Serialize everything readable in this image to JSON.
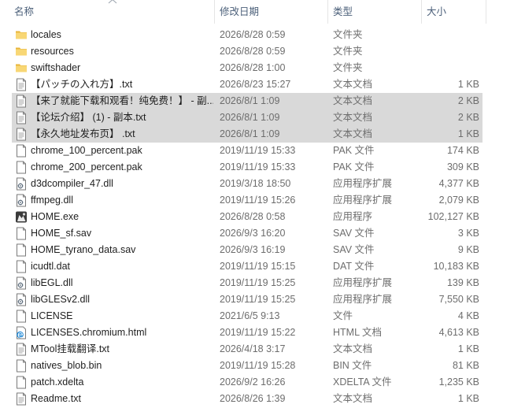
{
  "columns": {
    "name": "名称",
    "date": "修改日期",
    "type": "类型",
    "size": "大小"
  },
  "files": [
    {
      "name": "locales",
      "date": "2026/8/28 0:59",
      "type": "文件夹",
      "size": "",
      "icon": "folder-icon",
      "selected": false
    },
    {
      "name": "resources",
      "date": "2026/8/28 0:59",
      "type": "文件夹",
      "size": "",
      "icon": "folder-icon",
      "selected": false
    },
    {
      "name": "swiftshader",
      "date": "2026/8/28 1:00",
      "type": "文件夹",
      "size": "",
      "icon": "folder-icon",
      "selected": false
    },
    {
      "name": "【パッチの入れ方】.txt",
      "date": "2026/8/23 15:27",
      "type": "文本文档",
      "size": "1 KB",
      "icon": "text-file-icon",
      "selected": false
    },
    {
      "name": "【来了就能下载和观看！纯免费！】 - 副...",
      "date": "2026/8/1 1:09",
      "type": "文本文档",
      "size": "2 KB",
      "icon": "text-file-icon",
      "selected": true
    },
    {
      "name": "【论坛介绍】 (1) - 副本.txt",
      "date": "2026/8/1 1:09",
      "type": "文本文档",
      "size": "2 KB",
      "icon": "text-file-icon",
      "selected": true
    },
    {
      "name": "【永久地址发布页】 .txt",
      "date": "2026/8/1 1:09",
      "type": "文本文档",
      "size": "1 KB",
      "icon": "text-file-icon",
      "selected": true
    },
    {
      "name": "chrome_100_percent.pak",
      "date": "2019/11/19 15:33",
      "type": "PAK 文件",
      "size": "174 KB",
      "icon": "blank-file-icon",
      "selected": false
    },
    {
      "name": "chrome_200_percent.pak",
      "date": "2019/11/19 15:33",
      "type": "PAK 文件",
      "size": "309 KB",
      "icon": "blank-file-icon",
      "selected": false
    },
    {
      "name": "d3dcompiler_47.dll",
      "date": "2019/3/18 18:50",
      "type": "应用程序扩展",
      "size": "4,377 KB",
      "icon": "dll-file-icon",
      "selected": false
    },
    {
      "name": "ffmpeg.dll",
      "date": "2019/11/19 15:26",
      "type": "应用程序扩展",
      "size": "2,079 KB",
      "icon": "dll-file-icon",
      "selected": false
    },
    {
      "name": "HOME.exe",
      "date": "2026/8/28 0:58",
      "type": "应用程序",
      "size": "102,127 KB",
      "icon": "app-exe-icon",
      "selected": false
    },
    {
      "name": "HOME_sf.sav",
      "date": "2026/9/3 16:20",
      "type": "SAV 文件",
      "size": "3 KB",
      "icon": "blank-file-icon",
      "selected": false
    },
    {
      "name": "HOME_tyrano_data.sav",
      "date": "2026/9/3 16:19",
      "type": "SAV 文件",
      "size": "9 KB",
      "icon": "blank-file-icon",
      "selected": false
    },
    {
      "name": "icudtl.dat",
      "date": "2019/11/19 15:15",
      "type": "DAT 文件",
      "size": "10,183 KB",
      "icon": "blank-file-icon",
      "selected": false
    },
    {
      "name": "libEGL.dll",
      "date": "2019/11/19 15:25",
      "type": "应用程序扩展",
      "size": "139 KB",
      "icon": "dll-file-icon",
      "selected": false
    },
    {
      "name": "libGLESv2.dll",
      "date": "2019/11/19 15:25",
      "type": "应用程序扩展",
      "size": "7,550 KB",
      "icon": "dll-file-icon",
      "selected": false
    },
    {
      "name": "LICENSE",
      "date": "2021/6/5 9:13",
      "type": "文件",
      "size": "4 KB",
      "icon": "blank-file-icon",
      "selected": false
    },
    {
      "name": "LICENSES.chromium.html",
      "date": "2019/11/19 15:22",
      "type": "HTML 文档",
      "size": "4,613 KB",
      "icon": "edge-html-icon",
      "selected": false
    },
    {
      "name": "MTool挂载翻译.txt",
      "date": "2026/4/18 3:17",
      "type": "文本文档",
      "size": "1 KB",
      "icon": "text-file-icon",
      "selected": false
    },
    {
      "name": "natives_blob.bin",
      "date": "2019/11/19 15:28",
      "type": "BIN 文件",
      "size": "81 KB",
      "icon": "blank-file-icon",
      "selected": false
    },
    {
      "name": "patch.xdelta",
      "date": "2026/9/2 16:26",
      "type": "XDELTA 文件",
      "size": "1,235 KB",
      "icon": "blank-file-icon",
      "selected": false
    },
    {
      "name": "Readme.txt",
      "date": "2026/8/26 1:39",
      "type": "文本文档",
      "size": "1 KB",
      "icon": "text-file-icon",
      "selected": false
    }
  ]
}
